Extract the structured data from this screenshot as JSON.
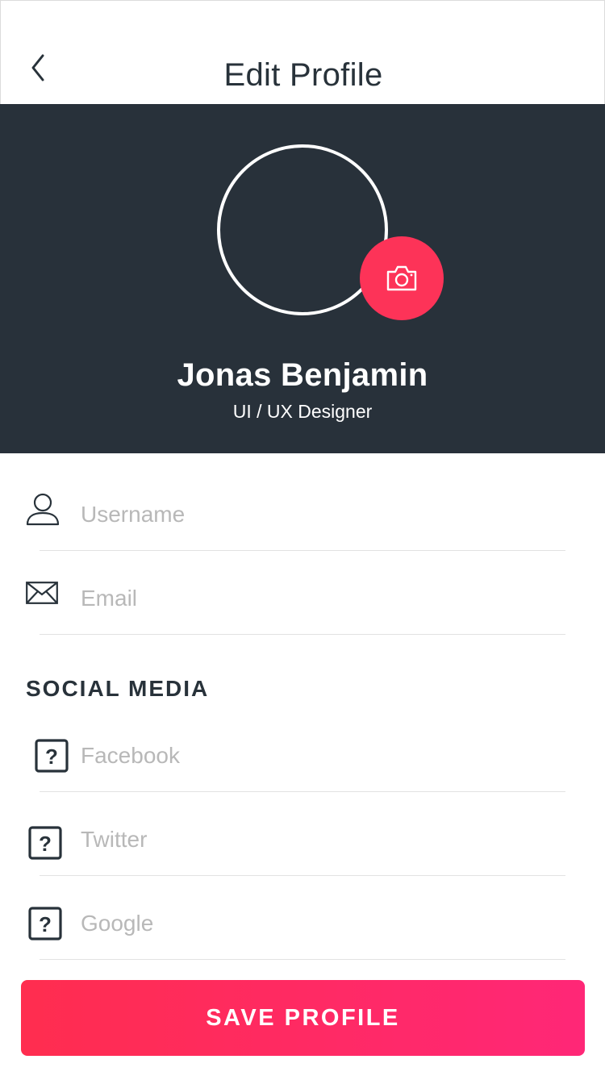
{
  "header": {
    "title": "Edit Profile",
    "back_icon": "chevron-left-icon"
  },
  "profile": {
    "name": "Jonas Benjamin",
    "role": "UI / UX Designer",
    "camera_icon": "camera-icon"
  },
  "fields": {
    "username": {
      "placeholder": "Username",
      "value": "",
      "icon": "user-icon"
    },
    "email": {
      "placeholder": "Email",
      "value": "",
      "icon": "envelope-icon"
    }
  },
  "social": {
    "heading": "SOCIAL MEDIA",
    "facebook": {
      "placeholder": "Facebook",
      "value": "",
      "icon": "question-box-icon"
    },
    "twitter": {
      "placeholder": "Twitter",
      "value": "",
      "icon": "question-box-icon"
    },
    "google": {
      "placeholder": "Google",
      "value": "",
      "icon": "question-box-icon"
    }
  },
  "actions": {
    "save_label": "SAVE PROFILE"
  },
  "colors": {
    "accent": "#fd3358",
    "hero_bg": "#28313a",
    "text": "#28323a",
    "placeholder": "#b8b8b8"
  }
}
